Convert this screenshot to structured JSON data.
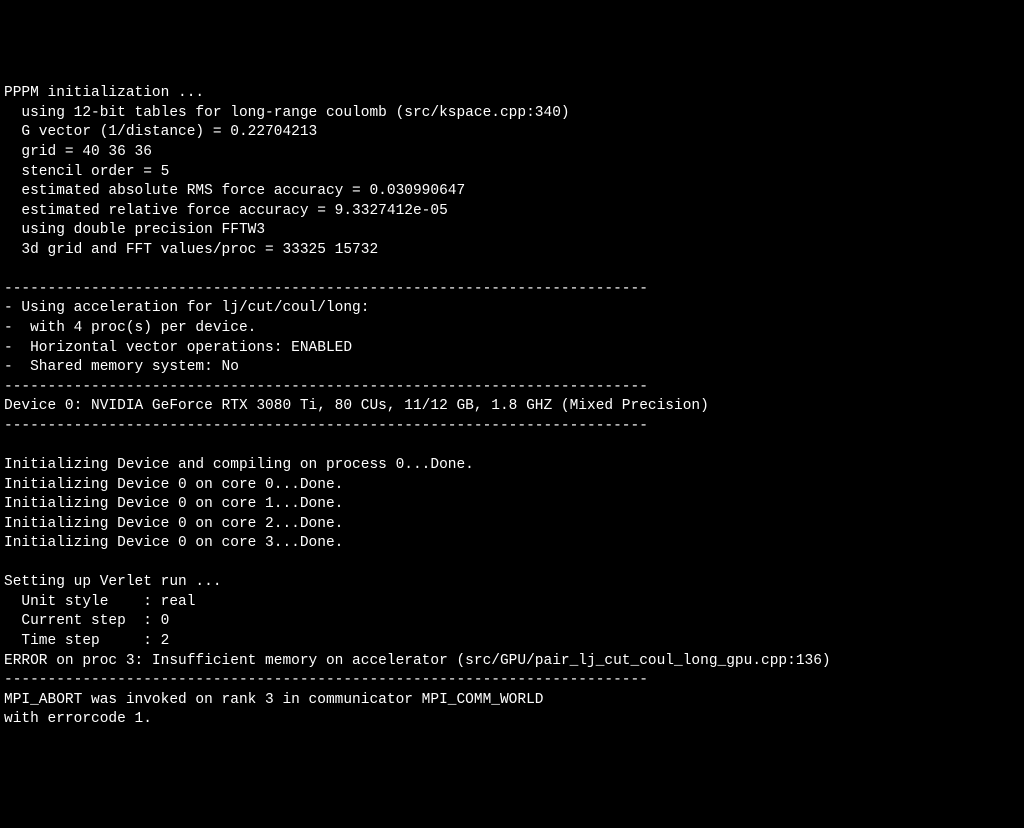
{
  "terminal": {
    "lines": [
      "PPPM initialization ...",
      "  using 12-bit tables for long-range coulomb (src/kspace.cpp:340)",
      "  G vector (1/distance) = 0.22704213",
      "  grid = 40 36 36",
      "  stencil order = 5",
      "  estimated absolute RMS force accuracy = 0.030990647",
      "  estimated relative force accuracy = 9.3327412e-05",
      "  using double precision FFTW3",
      "  3d grid and FFT values/proc = 33325 15732",
      "",
      "--------------------------------------------------------------------------",
      "- Using acceleration for lj/cut/coul/long:",
      "-  with 4 proc(s) per device.",
      "-  Horizontal vector operations: ENABLED",
      "-  Shared memory system: No",
      "--------------------------------------------------------------------------",
      "Device 0: NVIDIA GeForce RTX 3080 Ti, 80 CUs, 11/12 GB, 1.8 GHZ (Mixed Precision)",
      "--------------------------------------------------------------------------",
      "",
      "Initializing Device and compiling on process 0...Done.",
      "Initializing Device 0 on core 0...Done.",
      "Initializing Device 0 on core 1...Done.",
      "Initializing Device 0 on core 2...Done.",
      "Initializing Device 0 on core 3...Done.",
      "",
      "Setting up Verlet run ...",
      "  Unit style    : real",
      "  Current step  : 0",
      "  Time step     : 2",
      "ERROR on proc 3: Insufficient memory on accelerator (src/GPU/pair_lj_cut_coul_long_gpu.cpp:136)",
      "--------------------------------------------------------------------------",
      "MPI_ABORT was invoked on rank 3 in communicator MPI_COMM_WORLD",
      "with errorcode 1."
    ]
  }
}
